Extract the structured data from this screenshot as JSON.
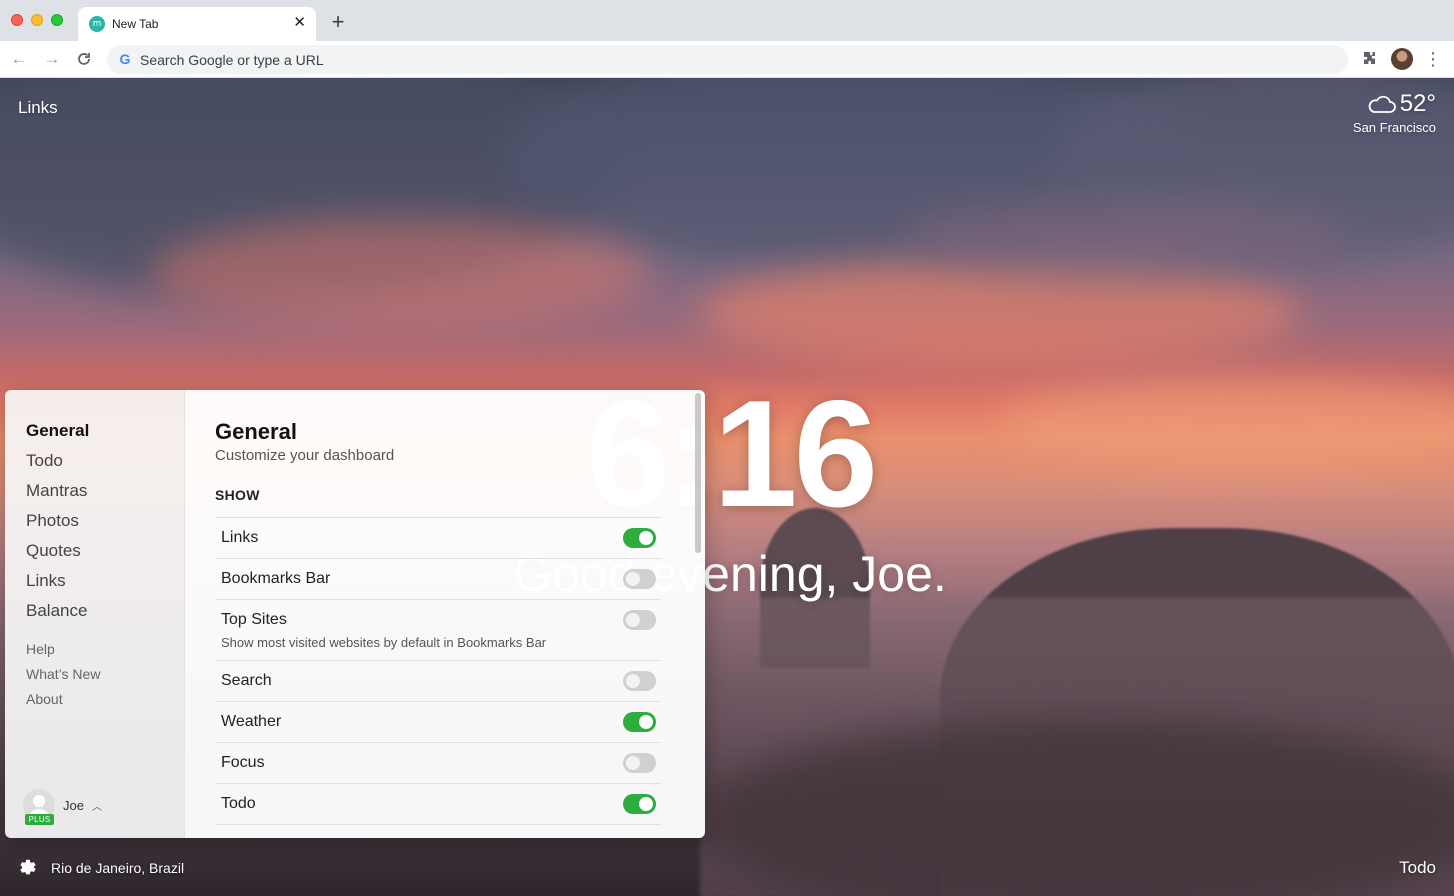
{
  "browser": {
    "tab_title": "New Tab",
    "tab_favicon": "m",
    "omnibox_placeholder": "Search Google or type a URL"
  },
  "dashboard": {
    "links_label": "Links",
    "weather": {
      "temp": "52°",
      "city": "San Francisco",
      "icon": "cloud-icon"
    },
    "clock": "6:16",
    "greeting": "Good evening, Joe.",
    "location": "Rio de Janeiro, Brazil",
    "todo_label": "Todo"
  },
  "settings": {
    "nav": [
      "General",
      "Todo",
      "Mantras",
      "Photos",
      "Quotes",
      "Links",
      "Balance"
    ],
    "active_nav": "General",
    "nav_secondary": [
      "Help",
      "What’s New",
      "About"
    ],
    "user": {
      "name": "Joe",
      "badge": "PLUS"
    },
    "title": "General",
    "subtitle": "Customize your dashboard",
    "show_header": "SHOW",
    "toggles": [
      {
        "label": "Links",
        "on": true
      },
      {
        "label": "Bookmarks Bar",
        "on": false
      },
      {
        "label": "Top Sites",
        "desc": "Show most visited websites by default in Bookmarks Bar",
        "on": false
      },
      {
        "label": "Search",
        "on": false
      },
      {
        "label": "Weather",
        "on": true
      },
      {
        "label": "Focus",
        "on": false
      },
      {
        "label": "Todo",
        "on": true
      }
    ]
  }
}
